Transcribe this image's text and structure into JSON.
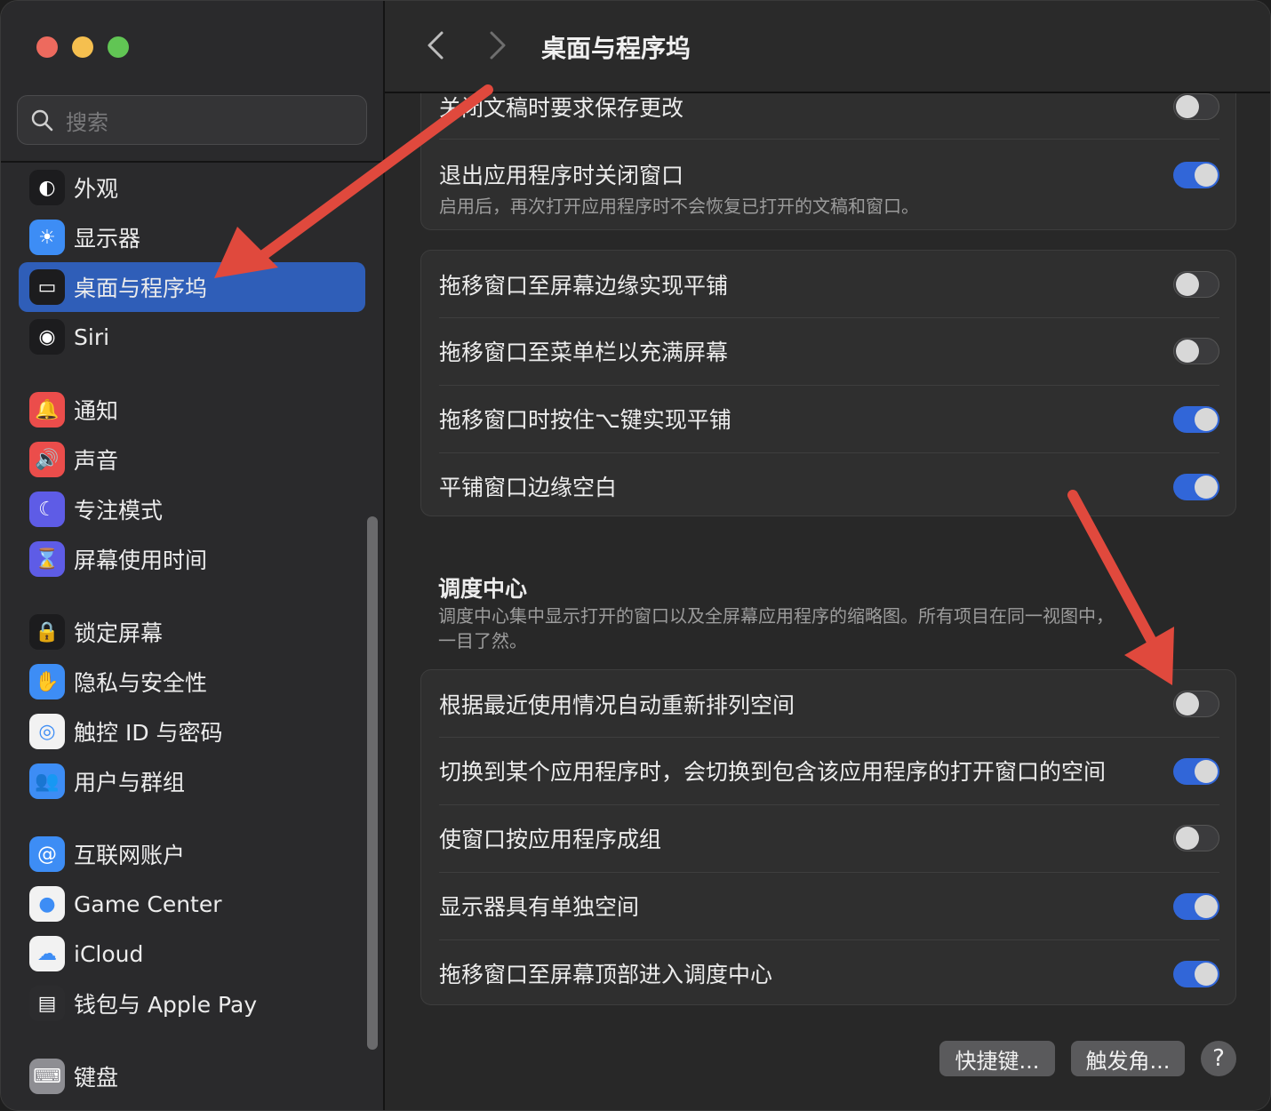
{
  "window": {
    "title": "桌面与程序坞"
  },
  "search": {
    "placeholder": "搜索"
  },
  "sidebar": {
    "items": [
      {
        "label": "外观",
        "icon": "appearance-icon",
        "color": "#1c1c1e"
      },
      {
        "label": "显示器",
        "icon": "display-icon",
        "color": "#3d8df5"
      },
      {
        "label": "桌面与程序坞",
        "icon": "dock-icon",
        "color": "#1c1c1e",
        "active": true
      },
      {
        "label": "Siri",
        "icon": "siri-icon",
        "color": "#1c1c1e"
      },
      {
        "label": "通知",
        "icon": "notification-icon",
        "color": "#eb4d4b"
      },
      {
        "label": "声音",
        "icon": "sound-icon",
        "color": "#eb4d4b"
      },
      {
        "label": "专注模式",
        "icon": "focus-moon-icon",
        "color": "#5e5ce6"
      },
      {
        "label": "屏幕使用时间",
        "icon": "hourglass-icon",
        "color": "#5e5ce6"
      },
      {
        "label": "锁定屏幕",
        "icon": "lock-icon",
        "color": "#1c1c1e"
      },
      {
        "label": "隐私与安全性",
        "icon": "hand-icon",
        "color": "#3d8df5"
      },
      {
        "label": "触控 ID 与密码",
        "icon": "fingerprint-icon",
        "color": "#f2f2f2"
      },
      {
        "label": "用户与群组",
        "icon": "users-icon",
        "color": "#3d8df5"
      },
      {
        "label": "互联网账户",
        "icon": "at-icon",
        "color": "#3d8df5"
      },
      {
        "label": "Game Center",
        "icon": "game-center-icon",
        "color": "#f2f2f2"
      },
      {
        "label": "iCloud",
        "icon": "icloud-icon",
        "color": "#f2f2f2"
      },
      {
        "label": "钱包与 Apple Pay",
        "icon": "wallet-icon",
        "color": "#2c2c2e"
      },
      {
        "label": "键盘",
        "icon": "keyboard-icon",
        "color": "#8e8e93"
      }
    ]
  },
  "group1": {
    "rows": [
      {
        "label": "关闭文稿时要求保存更改",
        "on": false
      },
      {
        "label": "退出应用程序时关闭窗口",
        "sub": "启用后，再次打开应用程序时不会恢复已打开的文稿和窗口。",
        "on": true
      }
    ]
  },
  "group2": {
    "rows": [
      {
        "label": "拖移窗口至屏幕边缘实现平铺",
        "on": false
      },
      {
        "label": "拖移窗口至菜单栏以充满屏幕",
        "on": false
      },
      {
        "label": "拖移窗口时按住⌥键实现平铺",
        "on": true
      },
      {
        "label": "平铺窗口边缘空白",
        "on": true
      }
    ]
  },
  "mission_control": {
    "title": "调度中心",
    "desc": "调度中心集中显示打开的窗口以及全屏幕应用程序的缩略图。所有项目在同一视图中，一目了然。"
  },
  "group3": {
    "rows": [
      {
        "label": "根据最近使用情况自动重新排列空间",
        "on": false
      },
      {
        "label": "切换到某个应用程序时，会切换到包含该应用程序的打开窗口的空间",
        "on": true
      },
      {
        "label": "使窗口按应用程序成组",
        "on": false
      },
      {
        "label": "显示器具有单独空间",
        "on": true
      },
      {
        "label": "拖移窗口至屏幕顶部进入调度中心",
        "on": true
      }
    ]
  },
  "buttons": {
    "shortcuts": "快捷键...",
    "hot_corners": "触发角...",
    "help": "?"
  },
  "colors": {
    "accent": "#2f5eb8",
    "toggle_on": "#3166d8",
    "annotation_arrow": "#e0493d"
  }
}
